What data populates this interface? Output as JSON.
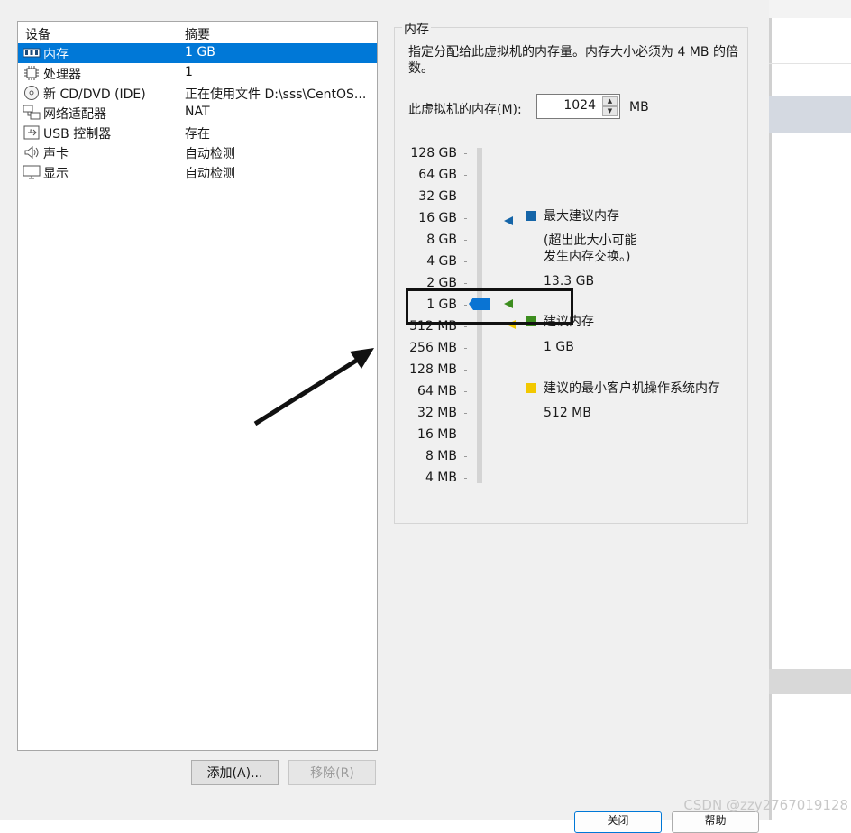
{
  "device_list": {
    "headers": {
      "device": "设备",
      "summary": "摘要"
    },
    "rows": [
      {
        "name": "内存",
        "summary": "1 GB",
        "icon": "memory-icon",
        "selected": true
      },
      {
        "name": "处理器",
        "summary": "1",
        "icon": "processor-icon"
      },
      {
        "name": "新 CD/DVD (IDE)",
        "summary": "正在使用文件 D:\\sss\\CentOS...",
        "icon": "cd-icon"
      },
      {
        "name": "网络适配器",
        "summary": "NAT",
        "icon": "network-icon"
      },
      {
        "name": "USB 控制器",
        "summary": "存在",
        "icon": "usb-icon"
      },
      {
        "name": "声卡",
        "summary": "自动检测",
        "icon": "speaker-icon"
      },
      {
        "name": "显示",
        "summary": "自动检测",
        "icon": "monitor-icon"
      }
    ]
  },
  "buttons": {
    "add": "添加(A)...",
    "remove": "移除(R)"
  },
  "memory_panel": {
    "title": "内存",
    "description": "指定分配给此虚拟机的内存量。内存大小必须为 4 MB 的倍数。",
    "memory_label": "此虚拟机的内存(M):",
    "memory_value": "1024",
    "unit": "MB",
    "scale_labels": [
      "128 GB",
      "64 GB",
      "32 GB",
      "16 GB",
      "8 GB",
      "4 GB",
      "2 GB",
      "1 GB",
      "512 MB",
      "256 MB",
      "128 MB",
      "64 MB",
      "32 MB",
      "16 MB",
      "8 MB",
      "4 MB"
    ],
    "legend": {
      "max_label": "最大建议内存",
      "max_note_1": "(超出此大小可能",
      "max_note_2": "发生内存交换。)",
      "max_value": "13.3 GB",
      "rec_label": "建议内存",
      "rec_value": "1 GB",
      "min_label": "建议的最小客户机操作系统内存",
      "min_value": "512 MB"
    },
    "colors": {
      "max": "#1565a8",
      "recommended": "#3c8d1e",
      "minimum": "#f2c800",
      "slider": "#0a74d3"
    }
  },
  "footer": {
    "ok": "关闭",
    "help": "帮助"
  },
  "watermark": "CSDN @zzy2767019128"
}
